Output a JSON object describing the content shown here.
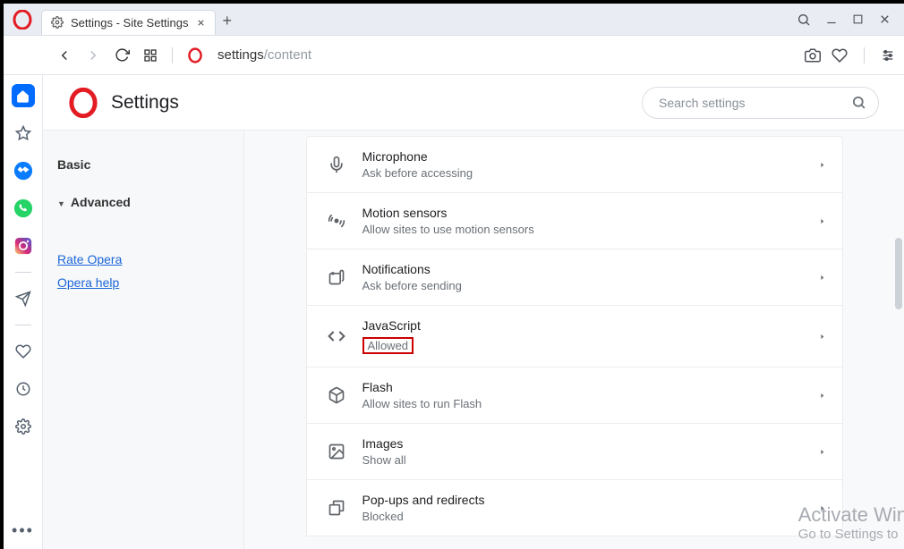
{
  "window": {
    "tab_title": "Settings - Site Settings"
  },
  "address": {
    "prefix": "settings",
    "suffix": "/content"
  },
  "settingsHeader": {
    "title": "Settings",
    "search_placeholder": "Search settings"
  },
  "sidebar": {
    "basic": "Basic",
    "advanced": "Advanced",
    "rate": "Rate Opera",
    "help": "Opera help"
  },
  "rows": [
    {
      "title": "Microphone",
      "sub": "Ask before accessing",
      "icon": "mic-icon",
      "highlight": false
    },
    {
      "title": "Motion sensors",
      "sub": "Allow sites to use motion sensors",
      "icon": "motion-icon",
      "highlight": false
    },
    {
      "title": "Notifications",
      "sub": "Ask before sending",
      "icon": "notify-icon",
      "highlight": false
    },
    {
      "title": "JavaScript",
      "sub": "Allowed",
      "icon": "code-icon",
      "highlight": true
    },
    {
      "title": "Flash",
      "sub": "Allow sites to run Flash",
      "icon": "cube-icon",
      "highlight": false
    },
    {
      "title": "Images",
      "sub": "Show all",
      "icon": "image-icon",
      "highlight": false
    },
    {
      "title": "Pop-ups and redirects",
      "sub": "Blocked",
      "icon": "popup-icon",
      "highlight": false
    }
  ],
  "watermark": {
    "big": "Activate Win",
    "small": "Go to Settings to"
  }
}
